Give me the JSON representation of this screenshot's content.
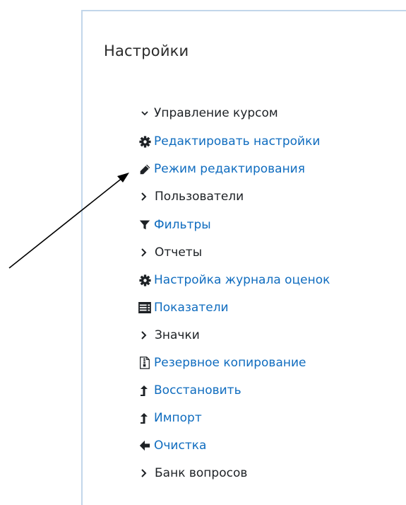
{
  "panel": {
    "title": "Настройки",
    "items": [
      {
        "label": "Управление курсом",
        "icon": "chevron-down-icon"
      },
      {
        "label": "Редактировать настройки",
        "icon": "gear-icon"
      },
      {
        "label": "Режим редактирования",
        "icon": "pencil-icon"
      },
      {
        "label": "Пользователи",
        "icon": "chevron-right-icon"
      },
      {
        "label": "Фильтры",
        "icon": "filter-icon"
      },
      {
        "label": "Отчеты",
        "icon": "chevron-right-icon"
      },
      {
        "label": "Настройка журнала оценок",
        "icon": "gear-icon"
      },
      {
        "label": "Показатели",
        "icon": "table-icon"
      },
      {
        "label": "Значки",
        "icon": "chevron-right-icon"
      },
      {
        "label": "Резервное копирование",
        "icon": "archive-icon"
      },
      {
        "label": "Восстановить",
        "icon": "upload-arrow-icon"
      },
      {
        "label": "Импорт",
        "icon": "upload-arrow-icon"
      },
      {
        "label": "Очистка",
        "icon": "arrow-left-icon"
      },
      {
        "label": "Банк вопросов",
        "icon": "chevron-right-icon"
      }
    ]
  },
  "colors": {
    "link": "#0f6cbf",
    "text": "#1d2125",
    "border": "#c2d6ea",
    "icon": "#1d2125"
  },
  "annotation": {
    "arrow_color": "#000000",
    "arrow_target": "Режим редактирования"
  }
}
